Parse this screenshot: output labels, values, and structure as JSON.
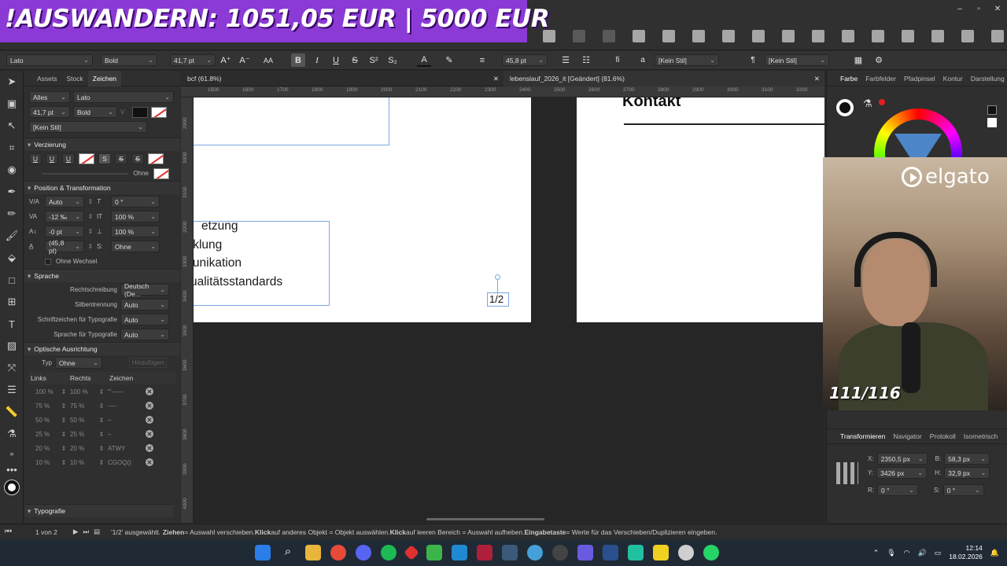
{
  "banner": {
    "text": "!AUSWANDERN: 1051,05 EUR | 5000 EUR"
  },
  "window": {
    "minimize": "–",
    "maximize": "▫",
    "close": "✕"
  },
  "context_toolbar": {
    "font_family": "Lato",
    "font_style": "Bold",
    "font_size": "41,7 pt",
    "grow_font": "A⁺",
    "shrink_font": "A⁻",
    "caps": "AA",
    "bold": "B",
    "italic": "I",
    "underline": "U",
    "strikethrough": "S",
    "superscript": "S²",
    "subscript": "S₂",
    "text_color": "A",
    "leading": "45,8 pt",
    "ligature": "fi",
    "paragraph_style_prefix": "a",
    "char_style": "[Kein Stil]",
    "pilcrow": "¶",
    "para_style": "[Kein Stil]"
  },
  "left_panel": {
    "tabs": [
      "Assets",
      "Stock",
      "Zeichen"
    ],
    "active_tab": "Zeichen",
    "scope": "Alles",
    "font_family": "Lato",
    "size": "41,7 pt",
    "style": "Bold",
    "char_style": "[Kein Stil]",
    "verzierung": {
      "title": "Verzierung",
      "buttons": [
        "U",
        "U",
        "U",
        "S",
        "S",
        "S"
      ],
      "line_label": "Ohne"
    },
    "position": {
      "title": "Position & Transformation",
      "tracking": "Auto",
      "kerning": "-12 ‰",
      "baseline": "-0 pt",
      "leading": "(45,8 pt)",
      "skew": "0 °",
      "hscale": "100 %",
      "vscale": "100 %",
      "caps": "Ohne",
      "no_break": "Ohne Wechsel"
    },
    "sprache": {
      "title": "Sprache",
      "rows": [
        {
          "label": "Rechtschreibung",
          "value": "Deutsch (De..."
        },
        {
          "label": "Silbentrennung",
          "value": "Auto"
        },
        {
          "label": "Schriftzeichen für Typografie",
          "value": "Auto"
        },
        {
          "label": "Sprache für Typografie",
          "value": "Auto"
        }
      ]
    },
    "optische": {
      "title": "Optische Ausrichtung",
      "typ_label": "Typ",
      "typ_value": "Ohne",
      "add_label": "Hinzufügen",
      "headers": [
        "Links",
        "Rechts",
        "Zeichen"
      ],
      "rows": [
        {
          "l": "100 %",
          "r": "100 %",
          "z": "'\"-–—"
        },
        {
          "l": "75 %",
          "r": "75 %",
          "z": "-—"
        },
        {
          "l": "50 %",
          "r": "50 %",
          "z": "–"
        },
        {
          "l": "25 %",
          "r": "25 %",
          "z": "–"
        },
        {
          "l": "20 %",
          "r": "20 %",
          "z": "ATWY"
        },
        {
          "l": "10 %",
          "r": "10 %",
          "z": "CGOQ()"
        }
      ]
    },
    "typografie": "Typografie"
  },
  "documents": {
    "tab1": "bcf (61.8%)",
    "tab2": "lebenslauf_2026_it [Geändert] (81.6%)",
    "close": "✕",
    "ruler_h": [
      "1500",
      "1600",
      "1700",
      "1800",
      "1900",
      "2000",
      "2100",
      "2200",
      "2300",
      "2400",
      "2500",
      "2600",
      "2700",
      "2800",
      "2900",
      "3000",
      "3100",
      "3200",
      "3300"
    ],
    "ruler_v": [
      "2900",
      "3000",
      "3100",
      "3200",
      "3300",
      "3400",
      "3500",
      "3600",
      "3700",
      "3800",
      "3900",
      "4000"
    ]
  },
  "canvas": {
    "lines": [
      "etzung",
      "icklung",
      "munikation",
      "ualitätsstandards"
    ],
    "page_number": "1/2",
    "kontakt": "Kontakt"
  },
  "right_panel": {
    "tabs": [
      "Farbe",
      "Farbfelder",
      "Pfadpinsel",
      "Kontur",
      "Darstellung"
    ],
    "active_tab": "Farbe",
    "lower_tabs": [
      "Transformieren",
      "Navigator",
      "Protokoll",
      "Isometrisch"
    ],
    "active_lower": "Transformieren",
    "x_label": "X:",
    "x": "2350,5 px",
    "y_label": "Y:",
    "y": "3426 px",
    "b_label": "B:",
    "b": "58,3 px",
    "h_label": "H:",
    "h": "32,9 px",
    "r_label": "R:",
    "r": "0 °",
    "s_label": "S:",
    "s": "0 °"
  },
  "webcam": {
    "brand": "elgato",
    "counter": "111/116"
  },
  "status": {
    "page": "1 von 2",
    "message_sel": "'1/2' ausgewählt.",
    "k1": "Ziehen",
    "t1": " = Auswahl verschieben. ",
    "k2": "Klick",
    "t2": " auf anderes Objekt = Objekt auswählen. ",
    "k3": "Klick",
    "t3": " auf leeren Bereich = Auswahl aufheben. ",
    "k4": "Eingabetaste",
    "t4": " = Werte für das Verschieben/Duplizieren eingeben."
  },
  "taskbar": {
    "time": "12:14",
    "date": "18.02.2026"
  },
  "colors": {
    "accent": "#8b3ad6",
    "selection": "#7aa7e0"
  }
}
